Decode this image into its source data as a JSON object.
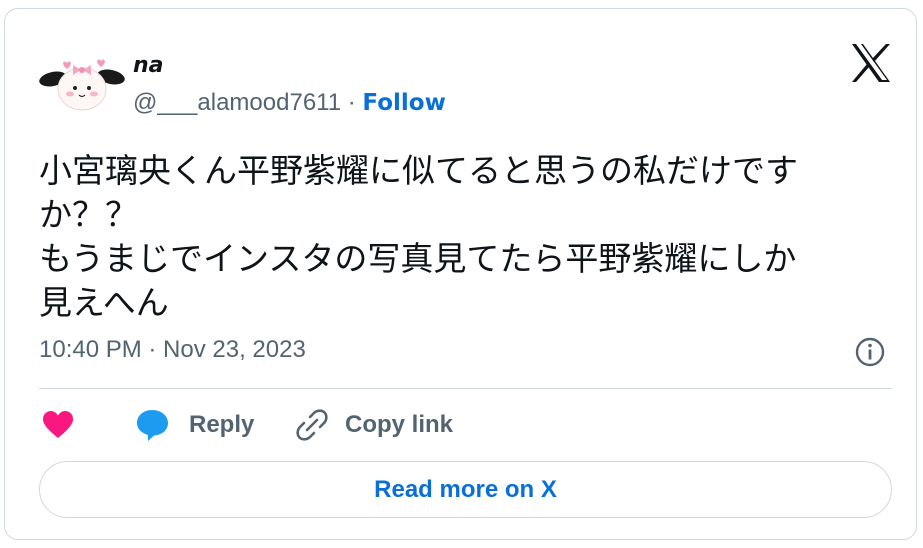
{
  "author": {
    "name": "na",
    "handle": "@___alamood7611",
    "separator": "·",
    "follow_label": "Follow"
  },
  "tweet": {
    "text": "小宮璃央くん平野紫耀に似てると思うの私だけです\nか？？\nもうまじでインスタの写真見てたら平野紫耀にしか\n見えへん",
    "timestamp": "10:40 PM · Nov 23, 2023"
  },
  "actions": {
    "reply_label": "Reply",
    "copy_link_label": "Copy link"
  },
  "footer": {
    "read_more_label": "Read more on X"
  },
  "colors": {
    "accent": "#0a6fd6",
    "heart": "#f91880",
    "reply_bubble": "#1d9bf0",
    "muted": "#536471",
    "text": "#0f1419",
    "border": "#cfd9de"
  },
  "icons": [
    "avatar",
    "x-logo-icon",
    "info-icon",
    "heart-icon",
    "reply-icon",
    "link-icon"
  ]
}
